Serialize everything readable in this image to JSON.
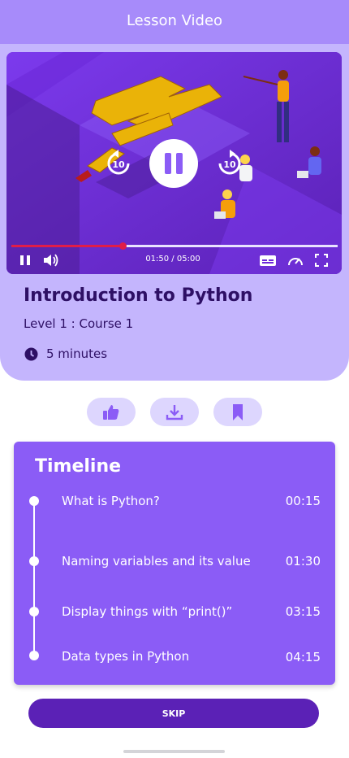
{
  "header": {
    "title": "Lesson Video"
  },
  "player": {
    "current_time": "01:50",
    "total_time": "05:00",
    "time_display": "01:50 / 05:00",
    "progress": 0.34,
    "rewind_seconds": "10",
    "forward_seconds": "10",
    "accent_color": "#e11d48"
  },
  "lesson": {
    "title": "Introduction to Python",
    "subtitle": "Level 1 : Course 1",
    "duration": "5 minutes"
  },
  "actions": [
    {
      "icon": "thumbs-up-icon"
    },
    {
      "icon": "download-icon"
    },
    {
      "icon": "bookmark-icon"
    }
  ],
  "timeline": {
    "title": "Timeline",
    "items": [
      {
        "label": "What is Python?",
        "time": "00:15"
      },
      {
        "label": "Naming variables and its value",
        "time": "01:30"
      },
      {
        "label": "Display things with “print()”",
        "time": "03:15"
      },
      {
        "label": "Data types in Python",
        "time": "04:15"
      }
    ]
  },
  "footer": {
    "skip_label": "SKIP"
  },
  "colors": {
    "brand": "#8b5cf6",
    "header": "#a78bfa",
    "hero": "#c4b5fd",
    "dark_text": "#2e1065",
    "button": "#5b21b6"
  }
}
